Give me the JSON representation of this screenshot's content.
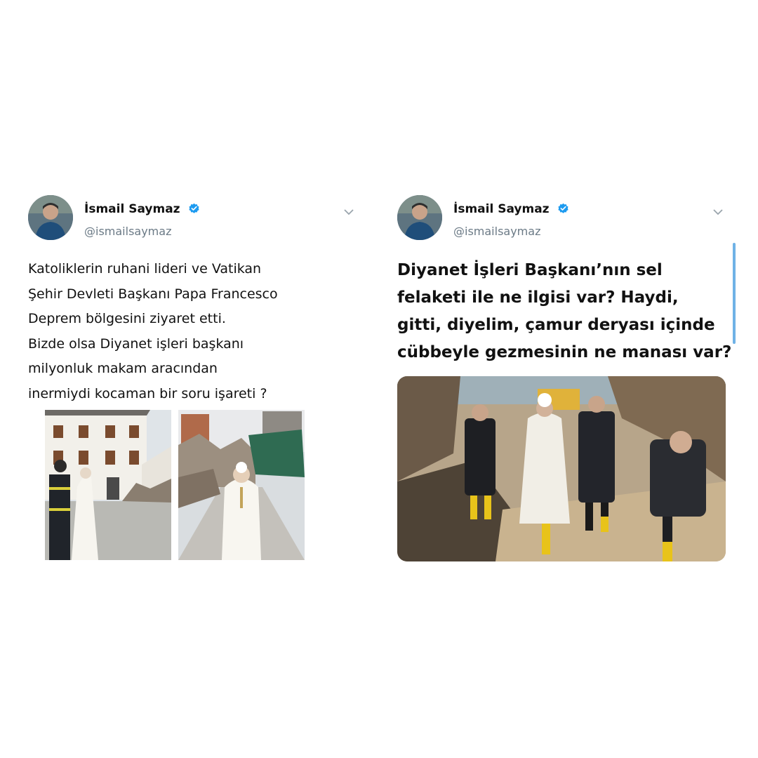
{
  "colors": {
    "verified": "#1d9bf0",
    "handle": "#6b7a86",
    "text": "#111111",
    "scrollbar": "#6fb2e6"
  },
  "tweets": [
    {
      "author": {
        "name": "İsmail Saymaz",
        "handle": "@ismailsaymaz",
        "verified_icon": "verified-badge-icon",
        "avatar_icon": "avatar"
      },
      "menu_icon": "chevron-down-icon",
      "text_lines": [
        "Katoliklerin ruhani lideri ve Vatikan",
        "Şehir Devleti Başkanı Papa Francesco",
        "Deprem bölgesini ziyaret etti.",
        "Bizde olsa Diyanet işleri başkanı",
        "milyonluk makam aracından",
        "inermiydi kocaman bir soru işareti ?"
      ],
      "media": [
        "photo-pope-with-firefighter",
        "photo-pope-in-rubble-street"
      ]
    },
    {
      "author": {
        "name": "İsmail Saymaz",
        "handle": "@ismailsaymaz",
        "verified_icon": "verified-badge-icon",
        "avatar_icon": "avatar"
      },
      "menu_icon": "chevron-down-icon",
      "text_lines": [
        "Diyanet İşleri Başkanı’nın sel",
        "felaketi ile ne ilgisi var? Haydi,",
        "gitti, diyelim, çamur deryası içinde",
        "cübbeyle gezmesinin ne manası var?"
      ],
      "media": [
        "photo-officials-walking-in-mud"
      ]
    }
  ]
}
